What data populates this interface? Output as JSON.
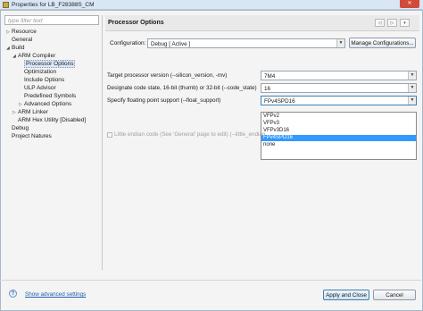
{
  "window": {
    "title": "Properties for LB_F28388S_CM",
    "close_label": "✕"
  },
  "filter": {
    "placeholder": "type filter text"
  },
  "tree": [
    {
      "label": "Resource",
      "twisty": "▷"
    },
    {
      "label": "General",
      "twisty": ""
    },
    {
      "label": "Build",
      "twisty": "◢"
    },
    {
      "label": "ARM Compiler",
      "twisty": "◢"
    },
    {
      "label": "Processor Options",
      "twisty": ""
    },
    {
      "label": "Optimization",
      "twisty": ""
    },
    {
      "label": "Include Options",
      "twisty": ""
    },
    {
      "label": "ULP Advisor",
      "twisty": ""
    },
    {
      "label": "Predefined Symbols",
      "twisty": ""
    },
    {
      "label": "Advanced Options",
      "twisty": "▷"
    },
    {
      "label": "ARM Linker",
      "twisty": "▷"
    },
    {
      "label": "ARM Hex Utility  [Disabled]",
      "twisty": ""
    },
    {
      "label": "Debug",
      "twisty": ""
    },
    {
      "label": "Project Natures",
      "twisty": ""
    }
  ],
  "page": {
    "title": "Processor Options",
    "nav_back": "◁",
    "nav_forward": "▷",
    "nav_menu": "▾"
  },
  "configuration": {
    "label": "Configuration:",
    "value": "Debug  [ Active ]",
    "manage_label": "Manage Configurations..."
  },
  "options": {
    "target_label": "Target processor version (--silicon_version, -mv)",
    "target_value": "7M4",
    "code_state_label": "Designate code state, 16-bit (thumb) or 32-bit (--code_state)",
    "code_state_value": "16",
    "float_label": "Specify floating point support (--float_support)",
    "float_value": "FPv4SPD16",
    "float_options": [
      "VFPv2",
      "VFPv3",
      "VFPv3D16",
      "FPv4SPD16",
      "none"
    ],
    "float_highlight_index": 3,
    "little_endian_label": "Little endian code (See 'General' page to edit) (--little_endian"
  },
  "footer": {
    "help_icon": "?",
    "advanced_link": "Show advanced settings",
    "apply_close_label": "Apply and Close",
    "cancel_label": "Cancel"
  }
}
